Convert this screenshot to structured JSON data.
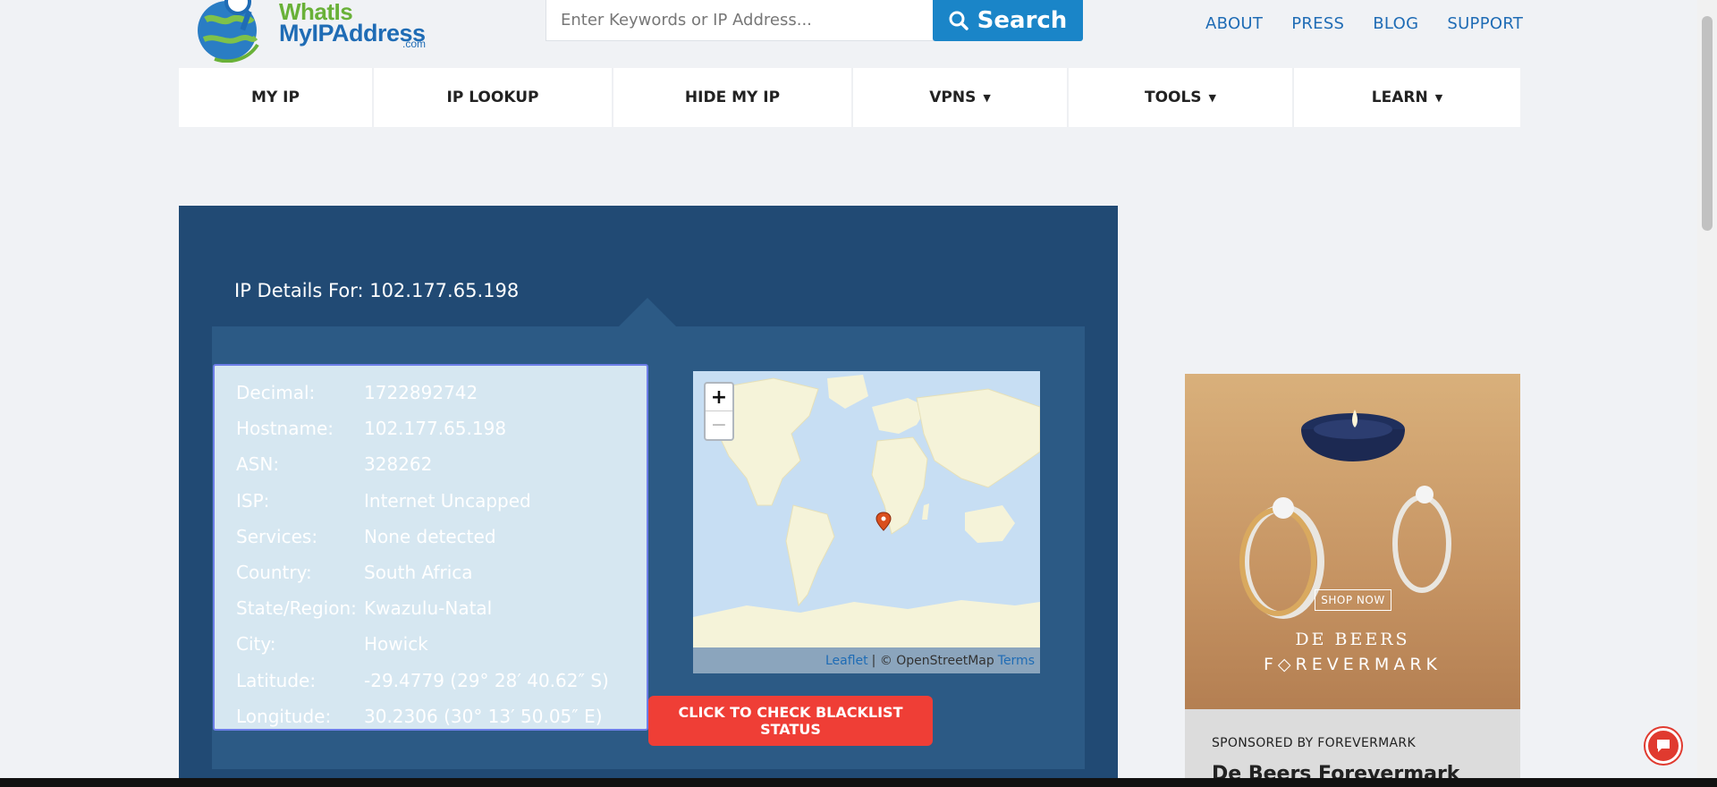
{
  "logo": {
    "line1": "WhatIs",
    "line2": "MyIPAddress",
    "line3": ".com"
  },
  "search": {
    "placeholder": "Enter Keywords or IP Address...",
    "button_label": "Search"
  },
  "top_links": [
    "ABOUT",
    "PRESS",
    "BLOG",
    "SUPPORT"
  ],
  "nav": {
    "items": [
      {
        "label": "MY IP",
        "caret": ""
      },
      {
        "label": "IP LOOKUP",
        "caret": ""
      },
      {
        "label": "HIDE MY IP",
        "caret": ""
      },
      {
        "label": "VPNS",
        "caret": "▼"
      },
      {
        "label": "TOOLS",
        "caret": "▼"
      },
      {
        "label": "LEARN",
        "caret": "▼"
      }
    ]
  },
  "panel": {
    "title": "IP Details For: 102.177.65.198",
    "details": [
      {
        "label": "Decimal:",
        "value": "1722892742"
      },
      {
        "label": "Hostname:",
        "value": "102.177.65.198"
      },
      {
        "label": "ASN:",
        "value": "328262"
      },
      {
        "label": "ISP:",
        "value": "Internet Uncapped"
      },
      {
        "label": "Services:",
        "value": "None detected"
      },
      {
        "label": "Country:",
        "value": "South Africa"
      },
      {
        "label": "State/Region:",
        "value": "Kwazulu-Natal"
      },
      {
        "label": "City:",
        "value": "Howick"
      },
      {
        "label": "Latitude:",
        "value": "-29.4779 (29° 28′ 40.62″ S)"
      },
      {
        "label": "Longitude:",
        "value": "30.2306 (30° 13′ 50.05″ E)"
      }
    ],
    "blacklist_button": "CLICK TO CHECK BLACKLIST STATUS"
  },
  "map": {
    "zoom_in": "+",
    "zoom_out": "−",
    "attribution_leaflet": "Leaflet",
    "attribution_sep": "| © OpenStreetMap",
    "attribution_terms": "Terms"
  },
  "ad": {
    "shop_now": "SHOP NOW",
    "brand_line1": "DE BEERS",
    "brand_line2": "F◇REVERMARK",
    "sponsored": "SPONSORED BY FOREVERMARK",
    "title": "De Beers Forevermark"
  },
  "colors": {
    "accent": "#1a85c8",
    "panel": "#214a74",
    "panel_inner": "#2c5a85",
    "details_bg": "#d6e7f1",
    "blacklist": "#ef3e36"
  }
}
